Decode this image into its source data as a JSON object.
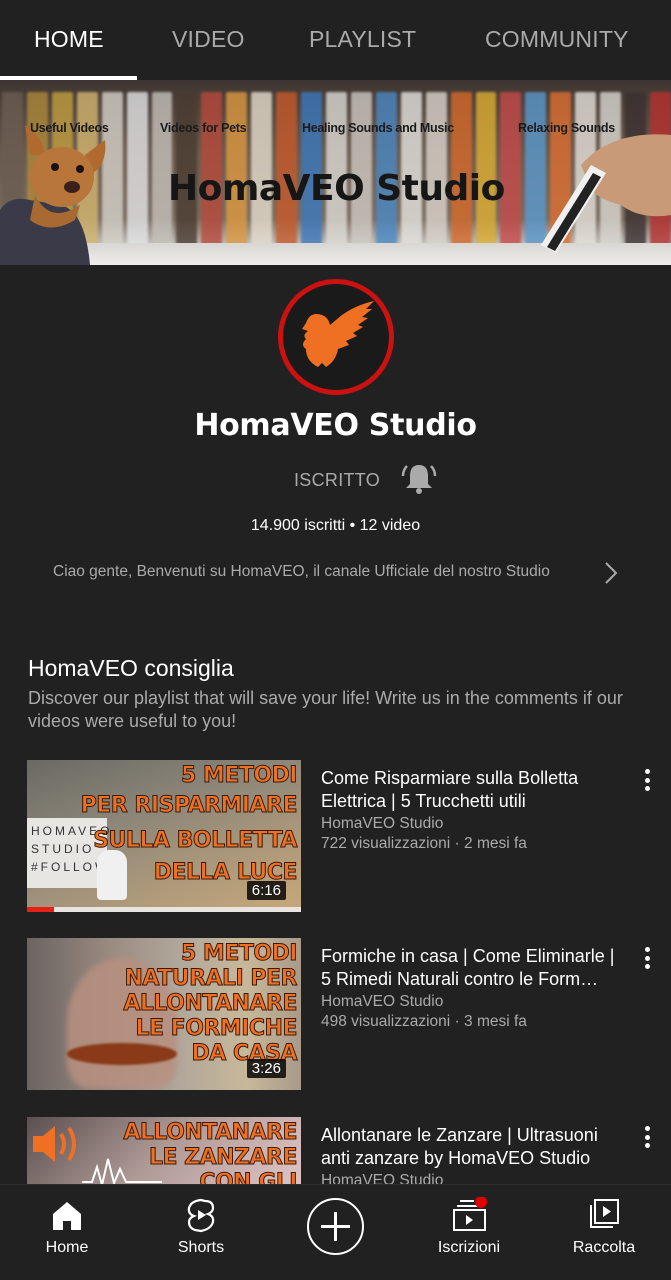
{
  "tabs": [
    {
      "label": "HOME",
      "active": true
    },
    {
      "label": "VIDEO",
      "active": false
    },
    {
      "label": "PLAYLIST",
      "active": false
    },
    {
      "label": "COMMUNITY",
      "active": false
    }
  ],
  "banner": {
    "labels": [
      "Useful Videos",
      "Videos for Pets",
      "Healing Sounds and Music",
      "Relaxing Sounds"
    ],
    "title": "HomaVEO Studio"
  },
  "channel": {
    "name": "HomaVEO Studio",
    "subscribe_state": "ISCRITTO",
    "notification_icon": "bell-ringing-icon",
    "stats": "14.900 iscritti • 12 video",
    "description": "Ciao gente, Benvenuti su HomaVEO, il canale Ufficiale del nostro Studio",
    "avatar_colors": {
      "ring": "#cc1111",
      "bird": "#f07023"
    }
  },
  "section": {
    "title": "HomaVEO consiglia",
    "description": "Discover our playlist that will save your life! Write us in the comments if our videos were useful to you!"
  },
  "videos": [
    {
      "title": "Come Risparmiare sulla Bolletta Elettrica | 5 Trucchetti utili",
      "channel": "HomaVEO Studio",
      "meta": "722 visualizzazioni · 2 mesi fa",
      "duration": "6:16",
      "thumb_text": [
        "5 METODI",
        "PER RISPARMIARE",
        "SULLA BOLLETTA",
        "DELLA LUCE"
      ],
      "watched_fraction": 0.1
    },
    {
      "title": "Formiche in casa | Come Eliminarle | 5 Rimedi Naturali contro le Form…",
      "channel": "HomaVEO Studio",
      "meta": "498 visualizzazioni · 3 mesi fa",
      "duration": "3:26",
      "thumb_text": [
        "5 METODI",
        "NATURALI PER",
        "ALLONTANARE",
        "LE FORMICHE",
        "DA CASA"
      ]
    },
    {
      "title": "Allontanare le Zanzare | Ultrasuoni anti zanzare by HomaVEO Studio",
      "channel": "HomaVEO Studio",
      "thumb_text": [
        "ALLONTANARE",
        "LE ZANZARE",
        "CON GLI"
      ]
    }
  ],
  "bottom_nav": [
    {
      "label": "Home",
      "icon": "home-icon"
    },
    {
      "label": "Shorts",
      "icon": "shorts-icon"
    },
    {
      "label": "",
      "icon": "create-plus-icon"
    },
    {
      "label": "Iscrizioni",
      "icon": "subscriptions-icon",
      "badge": true
    },
    {
      "label": "Raccolta",
      "icon": "library-icon"
    }
  ],
  "colors": {
    "background": "#212121",
    "text_primary": "#ffffff",
    "text_secondary": "#aaaaaa",
    "accent_red": "#e62117",
    "thumb_orange": "#f07023"
  }
}
